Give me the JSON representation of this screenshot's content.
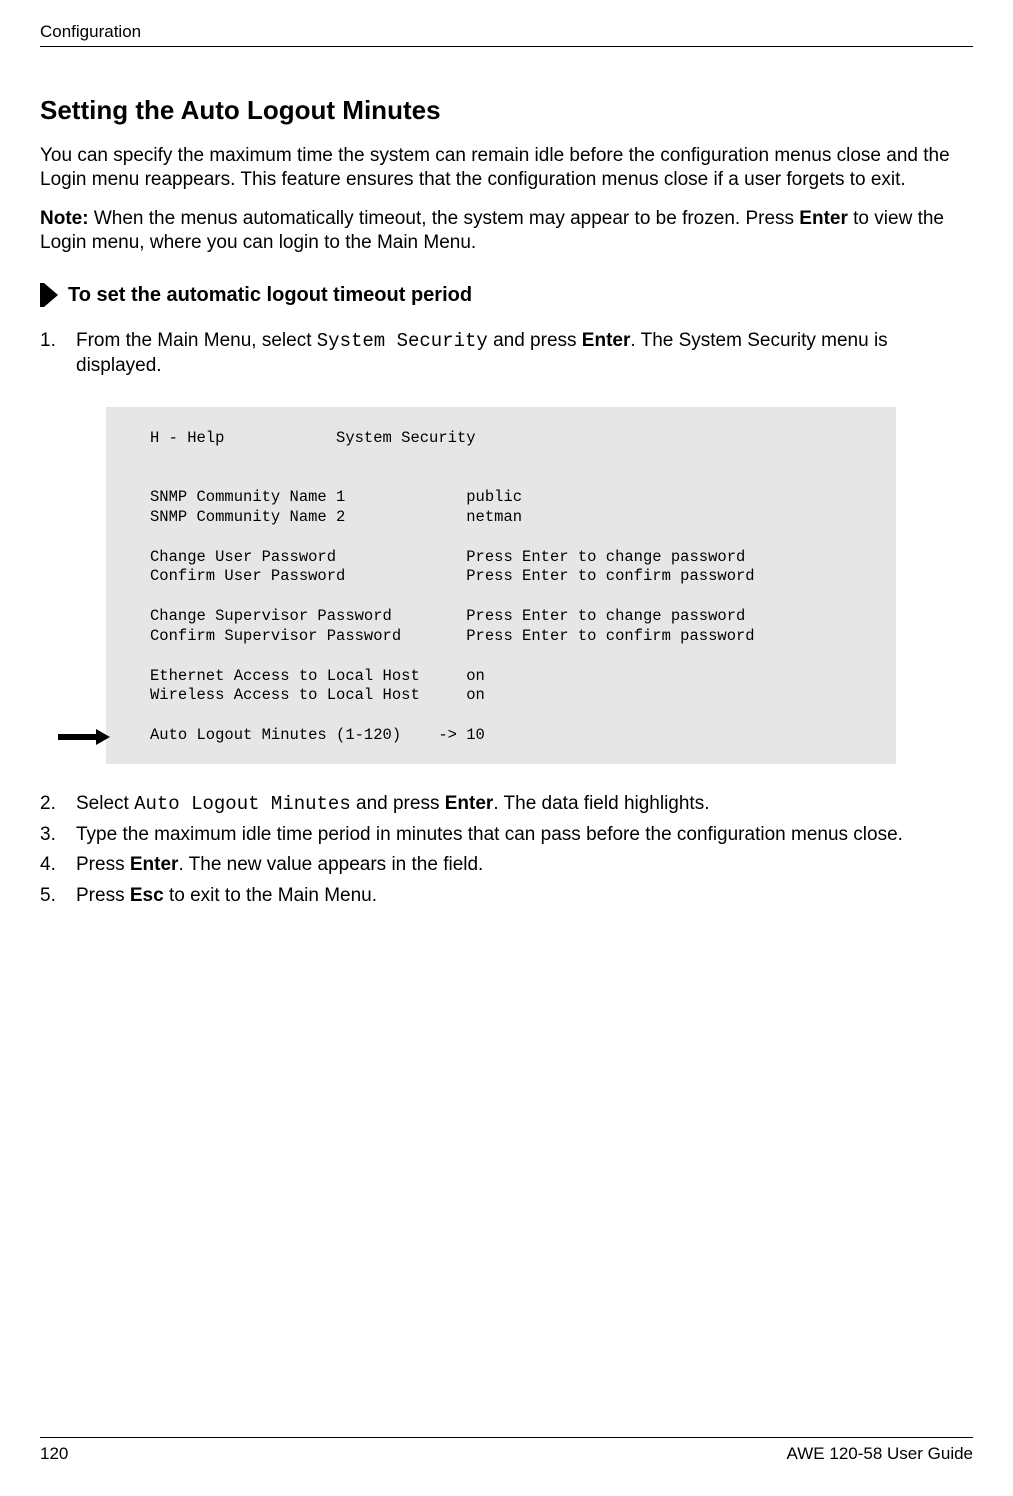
{
  "running_head": "Configuration",
  "section_title": "Setting the Auto Logout Minutes",
  "intro": "You can specify the maximum time the system can remain idle before the configuration menus close and the Login menu reappears. This feature ensures that the configuration menus close if a user forgets to exit.",
  "note_label": "Note:",
  "note_text": "When the menus automatically timeout, the system may appear to be frozen. Press ",
  "note_enter": "Enter",
  "note_text2": " to view the Login menu, where you can login to the Main Menu.",
  "proc_title": "To set the automatic logout timeout period",
  "steps": {
    "s1_a": "From the Main Menu, select ",
    "s1_code": "System Security",
    "s1_b": " and press ",
    "s1_bold": "Enter",
    "s1_c": ". The System Security menu is displayed.",
    "s2_a": "Select ",
    "s2_code": "Auto Logout Minutes",
    "s2_b": " and press ",
    "s2_bold": "Enter",
    "s2_c": ". The data field highlights.",
    "s3": "Type the maximum idle time period in minutes that can pass before the configuration menus close.",
    "s4_a": "Press ",
    "s4_bold": "Enter",
    "s4_b": ". The new value appears in the field.",
    "s5_a": "Press ",
    "s5_bold": "Esc",
    "s5_b": " to exit to the Main Menu."
  },
  "screen": {
    "l1": "H - Help            System Security",
    "l2": "",
    "l3": "",
    "l4": "SNMP Community Name 1             public",
    "l5": "SNMP Community Name 2             netman",
    "l6": "",
    "l7": "Change User Password              Press Enter to change password",
    "l8": "Confirm User Password             Press Enter to confirm password",
    "l9": "",
    "l10": "Change Supervisor Password        Press Enter to change password",
    "l11": "Confirm Supervisor Password       Press Enter to confirm password",
    "l12": "",
    "l13": "Ethernet Access to Local Host     on",
    "l14": "Wireless Access to Local Host     on",
    "l15": "",
    "l16": "Auto Logout Minutes (1-120)    -> 10"
  },
  "page_number": "120",
  "guide_title": "AWE 120-58 User Guide"
}
